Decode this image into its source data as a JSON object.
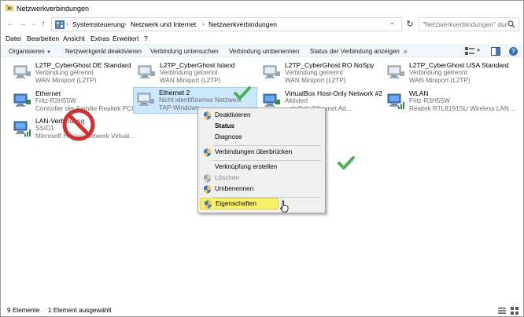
{
  "window": {
    "title": "Netzwerkverbindungen"
  },
  "address": {
    "crumbs": [
      "Systemsteuerung",
      "Netzwerk und Internet",
      "Netzwerkverbindungen"
    ],
    "search_placeholder": "\"Netzwerkverbindungen\" dur..."
  },
  "menubar": [
    "Datei",
    "Bearbeiten",
    "Ansicht",
    "Extras",
    "Erweitert",
    "?"
  ],
  "commandbar": {
    "organize": "Organisieren",
    "items": [
      "Netzwerkgerät deaktivieren",
      "Verbindung untersuchen",
      "Verbindung umbenennen",
      "Status der Verbindung anzeigen"
    ],
    "more": "»"
  },
  "items": [
    {
      "name": "L2TP_CyberGhost DE Standard",
      "line2": "Verbindung getrennt",
      "line3": "WAN Miniport (L2TP)",
      "icon": "vpn-computer-icon"
    },
    {
      "name": "L2TP_CyberGhost Island",
      "line2": "Verbindung getrennt",
      "line3": "WAN Miniport (L2TP)",
      "icon": "vpn-computer-icon"
    },
    {
      "name": "L2TP_CyberGhost RO NoSpy",
      "line2": "Verbindung getrennt",
      "line3": "WAN Miniport (L2TP)",
      "icon": "vpn-computer-icon"
    },
    {
      "name": "L2TP_CyberGhost USA Standard",
      "line2": "Verbindung getrennt",
      "line3": "WAN Miniport (L2TP)",
      "icon": "vpn-computer-icon"
    },
    {
      "name": "Ethernet",
      "line2": "Fritz-R3H55W",
      "line3": "Controller der Familie Realtek PCI...",
      "icon": "ethernet-icon"
    },
    {
      "name": "Ethernet 2",
      "line2": "Nicht identifiziertes Netzwerk",
      "line3": "TAP-Windows",
      "icon": "ethernet-icon"
    },
    {
      "name": "VirtualBox Host-Only Network #2",
      "line2": "Aktiviert",
      "line3": "...st-Only Ethernet Ad...",
      "icon": "ethernet-icon"
    },
    {
      "name": "WLAN",
      "line2": "Fritz-R3H55W",
      "line3": "Realtek RTL8191SU Wireless LAN ...",
      "icon": "wlan-icon"
    },
    {
      "name": "LAN-Verbindung",
      "line2": "SSID1",
      "line3": "Microsoft Hosted Network Virtual...",
      "icon": "wlan-icon"
    }
  ],
  "context_menu": {
    "items": [
      {
        "label": "Deaktivieren",
        "shield": true,
        "style": "normal"
      },
      {
        "label": "Status",
        "shield": false,
        "style": "bold"
      },
      {
        "label": "Diagnose",
        "shield": false,
        "style": "normal"
      },
      {
        "label": "Verbindungen überbrücken",
        "shield": true,
        "style": "normal"
      },
      {
        "label": "Verknüpfung erstellen",
        "shield": false,
        "style": "normal"
      },
      {
        "label": "Löschen",
        "shield": true,
        "style": "disabled"
      },
      {
        "label": "Umbenennen",
        "shield": true,
        "style": "normal"
      },
      {
        "label": "Eigenschaften",
        "shield": true,
        "style": "highlight"
      }
    ]
  },
  "status": {
    "count": "9 Elemente",
    "selection": "1 Element ausgewählt"
  },
  "colors": {
    "selection": "#cce8ff",
    "highlight": "#f7f168",
    "check": "#4caf50",
    "forbidden": "#d32f2f"
  }
}
